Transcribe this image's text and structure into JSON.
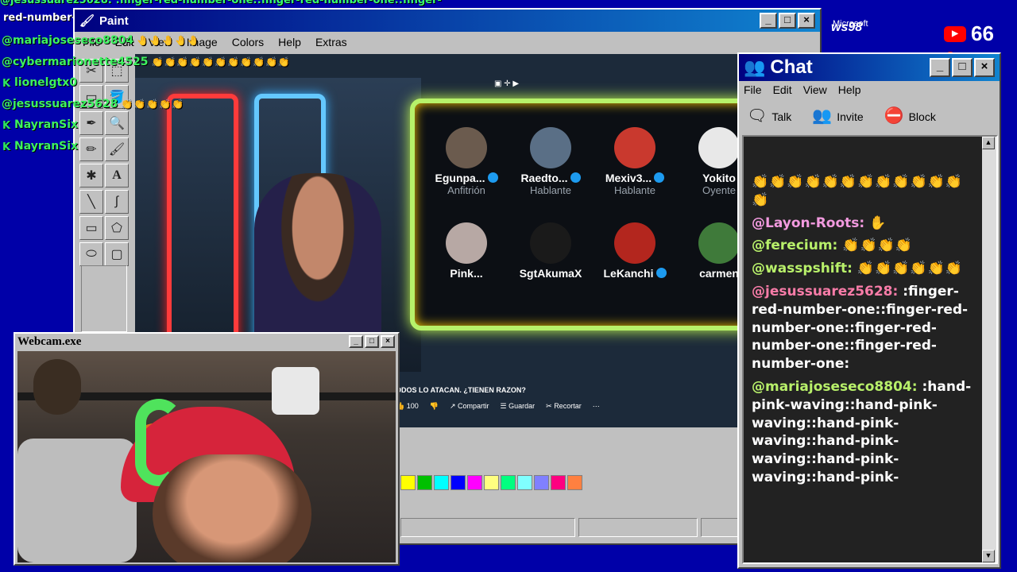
{
  "overlay": {
    "top_line_1": "@jesussuarez5628: :finger-red-number-one::finger-red-number-one::finger-",
    "top_line_2": "red-number-one::finger-red-number-one:",
    "rows": [
      {
        "platform": "youtube",
        "user": "@mariajoseseco8804",
        "user_color": "#3df25f",
        "emotes": "🤚🤚🤚🤚🤚"
      },
      {
        "platform": "youtube",
        "user": "@cybermarionette4525",
        "user_color": "#3df25f",
        "emotes": "👏👏👏👏👏👏👏👏👏👏👏"
      },
      {
        "platform": "kick",
        "user": "lionelgtx0",
        "user_color": "#3df25f",
        "emotes": ""
      },
      {
        "platform": "youtube",
        "user": "@jesussuarez5628",
        "user_color": "#3df25f",
        "emotes": "👏👏👏👏👏"
      },
      {
        "platform": "kick",
        "user": "NayranSix",
        "user_color": "#3df25f",
        "emotes": ""
      },
      {
        "platform": "kick",
        "user": "NayranSix",
        "user_color": "#3df25f",
        "emotes": ""
      }
    ]
  },
  "paint": {
    "title": "Paint",
    "menu": [
      "File",
      "Edit",
      "View",
      "Image",
      "Colors",
      "Help",
      "Extras"
    ],
    "palette": [
      "#ffff00",
      "#00c000",
      "#00ffff",
      "#0000ff",
      "#ff00ff",
      "#ffff80",
      "#00ff80",
      "#80ffff",
      "#8080ff",
      "#ff0080",
      "#ff8040"
    ],
    "stream": {
      "speakers": [
        {
          "name": "Egunpa...",
          "role": "Anfitrión",
          "verified": true,
          "avatar": "#6b5b4e"
        },
        {
          "name": "Raedto...",
          "role": "Hablante",
          "verified": true,
          "avatar": "#5a6f86"
        },
        {
          "name": "Mexiv3...",
          "role": "Hablante",
          "verified": true,
          "avatar": "#c9392e"
        },
        {
          "name": "Yokito",
          "role": "Oyente",
          "verified": false,
          "avatar": "#e8e8e8"
        },
        {
          "name": "Pink...",
          "role": "",
          "verified": false,
          "avatar": "#b7a8a4"
        },
        {
          "name": "SgtAkumaX",
          "role": "",
          "verified": false,
          "avatar": "#1a1a1a"
        },
        {
          "name": "LeKanchi",
          "role": "",
          "verified": true,
          "avatar": "#b3261e"
        },
        {
          "name": "carmen",
          "role": "",
          "verified": false,
          "avatar": "#3f7a3a"
        }
      ],
      "caption": "ODOS LO ATACAN. ¿TIENEN RAZON?",
      "likes": "100",
      "share": "Compartir",
      "save": "Guardar",
      "clip": "Recortar"
    }
  },
  "webcam": {
    "title": "Webcam.exe"
  },
  "chat": {
    "title": "Chat",
    "menu": [
      "File",
      "Edit",
      "View",
      "Help"
    ],
    "toolbar": [
      {
        "label": "Talk",
        "icon": "talk-icon",
        "glyph": "🗨"
      },
      {
        "label": "Invite",
        "icon": "invite-icon",
        "glyph": "👥"
      },
      {
        "label": "Block",
        "icon": "block-icon",
        "glyph": "⛔"
      }
    ],
    "messages": [
      {
        "user": "",
        "text": "👏👏👏👏👏👏👏👏👏👏👏👏👏",
        "color": ""
      },
      {
        "user": "@Layon-Roots:",
        "text": "✋",
        "color": "pink"
      },
      {
        "user": "@ferecium:",
        "text": "👏👏👏👏",
        "color": "green"
      },
      {
        "user": "@wasspshift:",
        "text": "👏👏👏👏👏👏",
        "color": "green"
      },
      {
        "user": "@jesussuarez5628:",
        "text": ":finger-red-number-one::finger-red-number-one::finger-red-number-one::finger-red-number-one:",
        "color": "red"
      },
      {
        "user": "@mariajoseseco8804:",
        "text": ":hand-pink-waving::hand-pink-waving::hand-pink-waving::hand-pink-waving::hand-pink-waving::hand-pink-",
        "color": "green"
      }
    ]
  },
  "brand": {
    "text": "ws98",
    "subtext": "Microsoft",
    "subscribers": "66"
  }
}
